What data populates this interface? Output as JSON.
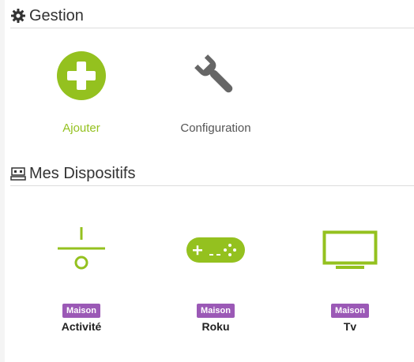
{
  "gestion": {
    "title": "Gestion",
    "actions": [
      {
        "label": "Ajouter",
        "icon": "plus-circle-icon",
        "color": "#94c11f"
      },
      {
        "label": "Configuration",
        "icon": "wrench-icon",
        "color": "#666666"
      }
    ]
  },
  "dispositifs": {
    "title": "Mes Dispositifs",
    "devices": [
      {
        "badge": "Maison",
        "name": "Activité",
        "icon": "activity-icon"
      },
      {
        "badge": "Maison",
        "name": "Roku",
        "icon": "gamepad-icon"
      },
      {
        "badge": "Maison",
        "name": "Tv",
        "icon": "tv-icon"
      }
    ]
  },
  "colors": {
    "accent": "#94c11f",
    "badge": "#9b59b6",
    "icon_gray": "#666666"
  }
}
